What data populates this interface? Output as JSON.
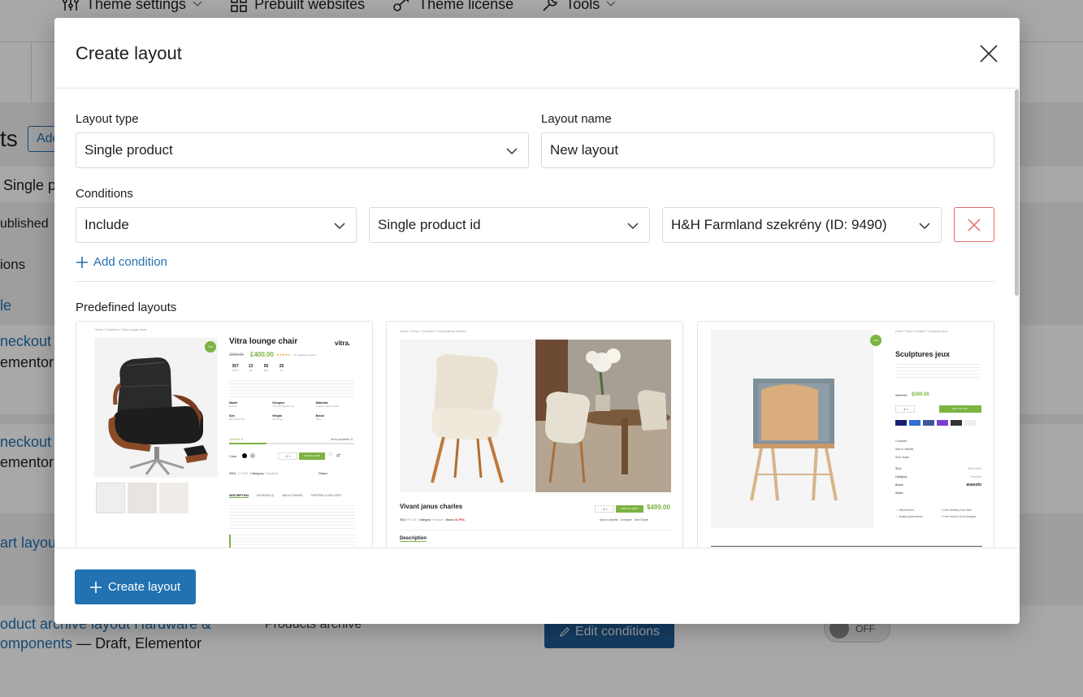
{
  "background": {
    "topnav": [
      {
        "icon": "sliders-icon",
        "label": "Theme settings",
        "has_dropdown": true
      },
      {
        "icon": "grid-icon",
        "label": "Prebuilt websites",
        "has_dropdown": false
      },
      {
        "icon": "key-icon",
        "label": "Theme license",
        "has_dropdown": false
      },
      {
        "icon": "wrench-icon",
        "label": "Tools",
        "has_dropdown": true
      }
    ],
    "page_title_fragment": "ts",
    "add_button_fragment": "Add",
    "tab_fragment": "Single p",
    "published_fragment": "ublished",
    "actions_fragment": "ions",
    "link_fragment_1": "le",
    "row1_title_fragment": "neckout l",
    "row1_sub_fragment": "ementor",
    "row2_title_fragment": "neckout l",
    "row2_sub_fragment": "ementor",
    "row3_title_fragment": "art layout",
    "row4_title": "oduct archive layout Hardware &",
    "row4_title_2": "omponents",
    "row4_suffix": " — Draft, Elementor",
    "row4_type": "Products archive",
    "edit_conditions_label": "Edit conditions",
    "toggle_label": "OFF"
  },
  "modal": {
    "title": "Create layout",
    "layout_type": {
      "label": "Layout type",
      "value": "Single product"
    },
    "layout_name": {
      "label": "Layout name",
      "value": "New layout"
    },
    "conditions": {
      "label": "Conditions",
      "rule": "Include",
      "field": "Single product id",
      "target": "H&H Farmland szekrény (ID: 9490)"
    },
    "add_condition_label": "Add condition",
    "predefined_label": "Predefined layouts",
    "cards": [
      {
        "breadcrumb": "Home / Furniture / Vitra lounge chair",
        "title": "Vitra lounge chair",
        "old_price": "£599.00",
        "price": "£400.00",
        "brand": "vitra.",
        "badge": "-33%",
        "reviews": "(1 customer review)",
        "countdown": [
          "357",
          "13",
          "55",
          "25"
        ],
        "countdown_labels": [
          "DAYS",
          "HR",
          "MIN",
          "SC"
        ],
        "spec_labels": [
          "Model",
          "Designer",
          "Materials",
          "Size",
          "Weight",
          "Brand"
        ],
        "spec_values": [
          "Eames",
          "Charles Ray Eames",
          "Leather, Metal, Wood",
          "84x77x86 CM",
          "12-18 Kg",
          "Vitra"
        ],
        "stock_left": "Ordered: 8",
        "stock_right": "Items available: 8",
        "color_label": "Color",
        "add_to_cart": "ADD TO CART",
        "sku_label": "SKU:",
        "sku_value": "LT-018",
        "category_label": "Category:",
        "category_value": "Furniture",
        "share_label": "Share:",
        "tabs": [
          "DESCRIPTION",
          "REVIEWS (1)",
          "ABOUT BRAND",
          "SHIPPING & DELIVERY"
        ]
      },
      {
        "breadcrumb": "Home / Shop / Furniture / Vivant janus charles",
        "title": "Vivant janus charles",
        "price": "$499.00",
        "add_to_cart": "ADD TO CART",
        "sku_label": "SKU:",
        "sku_value": "RT-104",
        "category_label": "Category:",
        "category_value": "Furniture",
        "brand_label": "Brand:",
        "brand_value": "ALPHA",
        "wishlist": "Add to wishlist",
        "compare": "Compare",
        "size_guide": "Size Guide",
        "tab": "Description"
      },
      {
        "breadcrumb": "Home / Shop / Furniture / Sculptures jeux",
        "title": "Sculptures jeux",
        "badge": "-25%",
        "old_price": "$399.00",
        "price": "$299.00",
        "add_to_cart": "ADD TO CART",
        "links": [
          "Compare",
          "Add to wishlist",
          "Size Guide"
        ],
        "meta_labels": [
          "SKU:",
          "Category:",
          "Brand:",
          "Share:"
        ],
        "meta_values": [
          "BSG-0051",
          "Furniture",
          "avasolo",
          ""
        ],
        "features": [
          "Official store",
          "Free delivery from $99",
          "Quality guaranteed",
          "Free returns & exchanges"
        ]
      }
    ],
    "create_button_label": "Create layout"
  },
  "colors": {
    "primary": "#2271b1",
    "danger": "#e36a6a",
    "success": "#7cb342",
    "overlay": "rgba(0,0,0,0.34)"
  }
}
